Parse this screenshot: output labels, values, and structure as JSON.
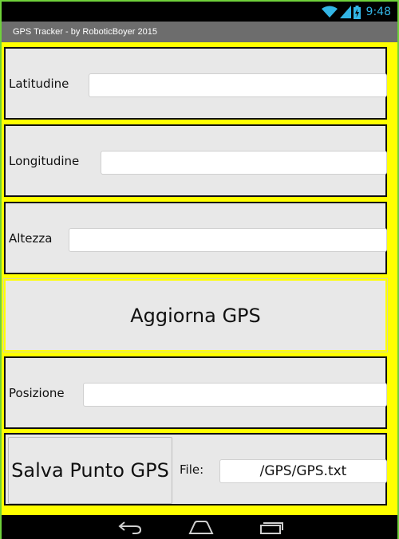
{
  "status_bar": {
    "time": "9:48",
    "icons": [
      "wifi-icon",
      "signal-icon",
      "battery-icon"
    ],
    "accent_color": "#33b5e5"
  },
  "app": {
    "title": "GPS Tracker - by RoboticBoyer 2015"
  },
  "form": {
    "latitude": {
      "label": "Latitudine",
      "value": ""
    },
    "longitude": {
      "label": "Longitudine",
      "value": ""
    },
    "altitude": {
      "label": "Altezza",
      "value": ""
    },
    "update_button": "Aggiorna GPS",
    "position": {
      "label": "Posizione",
      "value": ""
    },
    "save_button": "Salva Punto GPS",
    "file": {
      "label": "File:",
      "value": "/GPS/GPS.txt"
    }
  },
  "nav_bar": {
    "icons": [
      "back-icon",
      "home-icon",
      "recents-icon"
    ]
  },
  "colors": {
    "background": "#ffff00",
    "row_background": "#e8e8e8",
    "title_bar": "#6d6d6d",
    "frame_border": "#6fd13a"
  }
}
